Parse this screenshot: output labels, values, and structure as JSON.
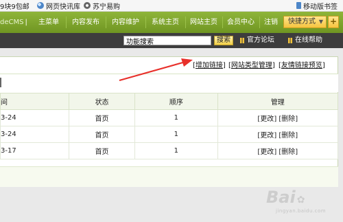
{
  "bookmarks": [
    {
      "label": "9块9包邮",
      "icon": "page-icon"
    },
    {
      "label": "网页快讯库",
      "icon": "globe-icon"
    },
    {
      "label": "苏宁易购",
      "icon": "gear-icon"
    },
    {
      "label": "移动版书签",
      "icon": "mobile-icon"
    }
  ],
  "nav": {
    "brand": "deCMS",
    "items": [
      "主菜单",
      "内容发布",
      "内容维护",
      "系统主页",
      "网站主页",
      "会员中心",
      "注销"
    ],
    "quick": "快捷方式",
    "plus": "+"
  },
  "searchbar": {
    "input_value": "功能搜索",
    "button": "搜索",
    "forum": "官方论坛",
    "help": "在线帮助"
  },
  "panel": {
    "links": [
      "增加链接",
      "网站类型管理",
      "友情链接预览"
    ]
  },
  "table": {
    "headers": [
      "间",
      "状态",
      "顺序",
      "管理"
    ],
    "rows": [
      {
        "date": "3-24",
        "status": "首页",
        "order": "1",
        "edit": "更改",
        "delete": "删除"
      },
      {
        "date": "3-24",
        "status": "首页",
        "order": "1",
        "edit": "更改",
        "delete": "删除"
      },
      {
        "date": "3-17",
        "status": "首页",
        "order": "1",
        "edit": "更改",
        "delete": "删除"
      }
    ]
  },
  "colors": {
    "nav_green": "#7aa22b",
    "search_dark": "#3d3d3d",
    "arrow_red": "#e8302a",
    "quick_yellow": "#f6c43f"
  },
  "watermark": {
    "text": "Bai",
    "sub": "jingyan.baidu.com"
  }
}
